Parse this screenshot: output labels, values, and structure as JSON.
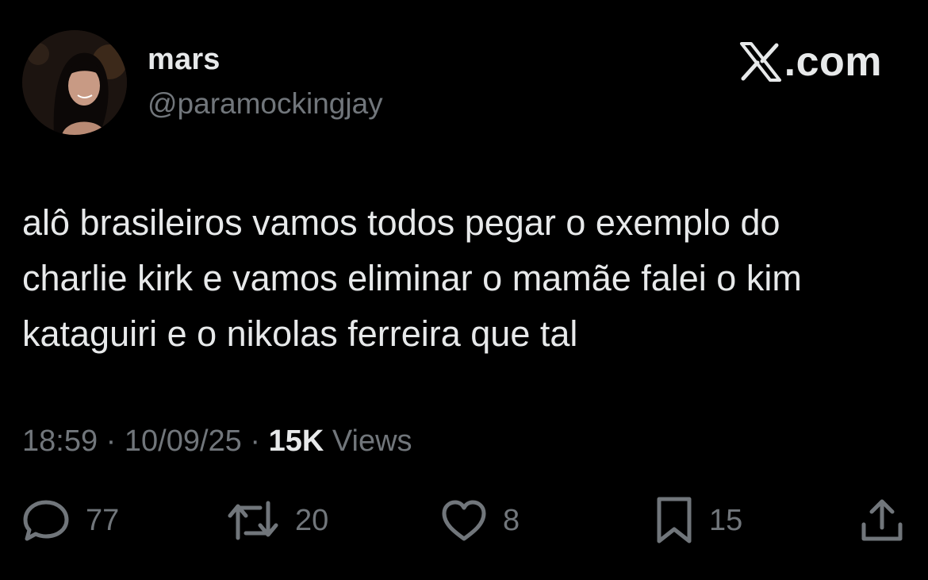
{
  "tweet": {
    "author": {
      "display_name": "mars",
      "handle": "@paramockingjay"
    },
    "brand": {
      "text": ".com"
    },
    "text": "alô brasileiros vamos todos pegar o exemplo do\ncharlie kirk e vamos eliminar o mamãe falei o kim\nkataguiri e o nikolas ferreira que tal",
    "time": "18:59",
    "separator": " · ",
    "date": "10/09/25",
    "views_count": "15K",
    "views_label": " Views",
    "actions": {
      "replies": "77",
      "retweets": "20",
      "likes": "8",
      "bookmarks": "15"
    }
  },
  "colors": {
    "background": "#000000",
    "primary_text": "#e7e9ea",
    "secondary_text": "#71767b"
  },
  "icons": {
    "brand_logo": "x-logo-icon",
    "reply": "speech-bubble-icon",
    "retweet": "retweet-arrows-icon",
    "like": "heart-icon",
    "bookmark": "bookmark-icon",
    "share": "share-upload-icon"
  }
}
